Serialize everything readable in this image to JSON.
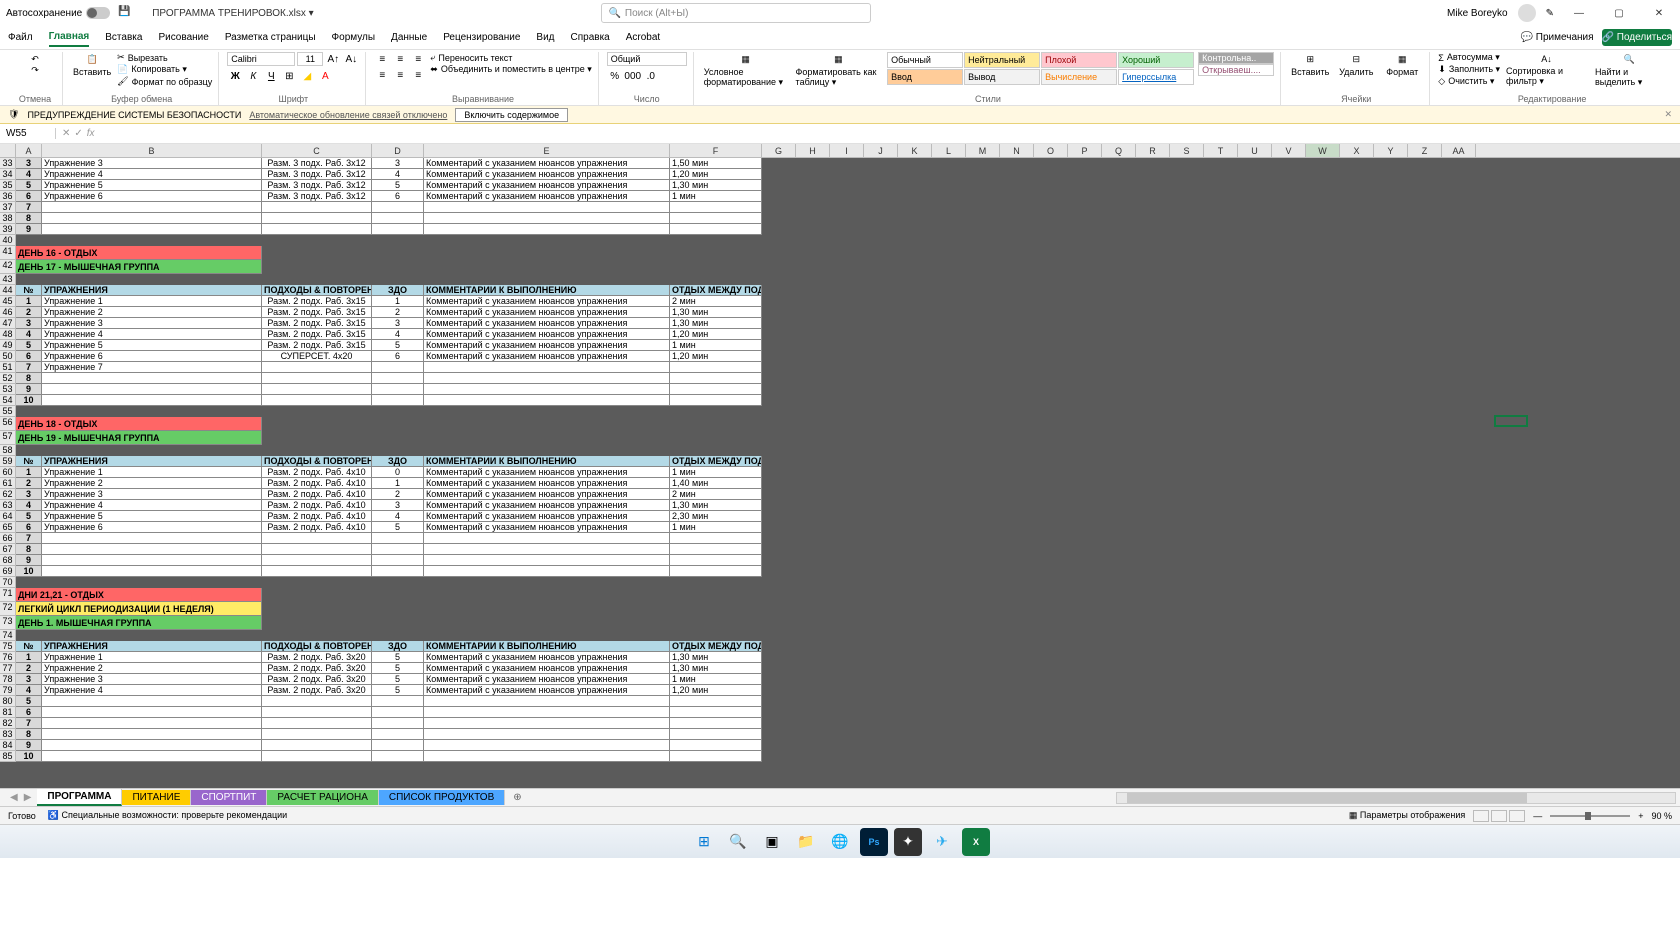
{
  "titleBar": {
    "autosave": "Автосохранение",
    "docTitle": "ПРОГРАММА ТРЕНИРОВОК.xlsx ▾",
    "searchPlaceholder": "Поиск (Alt+Ы)",
    "user": "Mike Boreyko"
  },
  "tabs": {
    "items": [
      "Файл",
      "Главная",
      "Вставка",
      "Рисование",
      "Разметка страницы",
      "Формулы",
      "Данные",
      "Рецензирование",
      "Вид",
      "Справка",
      "Acrobat"
    ],
    "active": "Главная",
    "comments": "Примечания",
    "share": "Поделиться"
  },
  "ribbon": {
    "undo": "Отмена",
    "paste": "Вставить",
    "clipboard": [
      "Вырезать",
      "Копировать ▾",
      "Формат по образцу"
    ],
    "clipboardLabel": "Буфер обмена",
    "font": "Calibri",
    "fontSize": "11",
    "fontLabel": "Шрифт",
    "wrap": "Переносить текст",
    "merge": "Объединить и поместить в центре ▾",
    "alignLabel": "Выравнивание",
    "numberFormat": "Общий",
    "numberLabel": "Число",
    "condFormat": "Условное форматирование ▾",
    "formatTable": "Форматировать как таблицу ▾",
    "styles": [
      "Обычный",
      "Нейтральный",
      "Плохой",
      "Хороший",
      "Ввод",
      "Вывод",
      "Вычисление",
      "Гиперссылка",
      "Контрольна..",
      "Открываеш...."
    ],
    "stylesLabel": "Стили",
    "insert": "Вставить",
    "delete": "Удалить",
    "format": "Формат",
    "cellsLabel": "Ячейки",
    "autosum": "Автосумма ▾",
    "fill": "Заполнить ▾",
    "clear": "Очистить ▾",
    "sort": "Сортировка и фильтр ▾",
    "find": "Найти и выделить ▾",
    "editLabel": "Редактирование"
  },
  "warning": {
    "label": "ПРЕДУПРЕЖДЕНИЕ СИСТЕМЫ БЕЗОПАСНОСТИ",
    "msg": "Автоматическое обновление связей отключено",
    "btn": "Включить содержимое"
  },
  "nameBox": "W55",
  "columns": [
    "A",
    "B",
    "C",
    "D",
    "E",
    "F",
    "G",
    "H",
    "I",
    "J",
    "K",
    "L",
    "M",
    "N",
    "O",
    "P",
    "Q",
    "R",
    "S",
    "T",
    "U",
    "V",
    "W",
    "X",
    "Y",
    "Z",
    "AA"
  ],
  "rowNums": [
    33,
    34,
    35,
    36,
    37,
    38,
    39,
    40,
    41,
    42,
    43,
    44,
    45,
    46,
    47,
    48,
    49,
    50,
    51,
    52,
    53,
    54,
    55,
    56,
    57,
    58,
    59,
    60,
    61,
    62,
    63,
    64,
    65,
    66,
    67,
    68,
    69,
    70,
    71,
    72,
    73,
    74,
    75,
    76,
    77,
    78,
    79,
    80,
    81,
    82,
    83,
    84,
    85
  ],
  "headers": {
    "num": "№",
    "ex": "УПРАЖНЕНИЯ",
    "sets": "ПОДХОДЫ & ПОВТОРЕНИЯ",
    "zdo": "ЗДО",
    "comm": "КОММЕНТАРИИ К ВЫПОЛНЕНИЮ",
    "rest": "ОТДЫХ МЕЖДУ ПОДХ."
  },
  "block1": {
    "rows": [
      {
        "n": "3",
        "ex": "Упражнение 3",
        "sets": "Разм. 3 подх. Раб. 3х12",
        "zdo": "3",
        "comm": "Комментарий с указанием нюансов упражнения",
        "rest": "1,50 мин"
      },
      {
        "n": "4",
        "ex": "Упражнение 4",
        "sets": "Разм. 3 подх. Раб. 3х12",
        "zdo": "4",
        "comm": "Комментарий с указанием нюансов упражнения",
        "rest": "1,20 мин"
      },
      {
        "n": "5",
        "ex": "Упражнение 5",
        "sets": "Разм. 3 подх. Раб. 3х12",
        "zdo": "5",
        "comm": "Комментарий с указанием нюансов упражнения",
        "rest": "1,30 мин"
      },
      {
        "n": "6",
        "ex": "Упражнение 6",
        "sets": "Разм. 3 подх. Раб. 3х12",
        "zdo": "6",
        "comm": "Комментарий с указанием нюансов упражнения",
        "rest": "1 мин"
      }
    ],
    "tail": [
      "7",
      "8",
      "9"
    ]
  },
  "day16": "ДЕНЬ 16 - ОТДЫХ",
  "day17": "ДЕНЬ 17 - МЫШЕЧНАЯ ГРУППА",
  "block2": {
    "rows": [
      {
        "n": "1",
        "ex": "Упражнение 1",
        "sets": "Разм. 2 подх. Раб. 3х15",
        "zdo": "1",
        "comm": "Комментарий с указанием нюансов упражнения",
        "rest": "2 мин"
      },
      {
        "n": "2",
        "ex": "Упражнение 2",
        "sets": "Разм. 2 подх. Раб. 3х15",
        "zdo": "2",
        "comm": "Комментарий с указанием нюансов упражнения",
        "rest": "1,30 мин"
      },
      {
        "n": "3",
        "ex": "Упражнение 3",
        "sets": "Разм. 2 подх. Раб. 3х15",
        "zdo": "3",
        "comm": "Комментарий с указанием нюансов упражнения",
        "rest": "1,30 мин"
      },
      {
        "n": "4",
        "ex": "Упражнение 4",
        "sets": "Разм. 2 подх. Раб. 3х15",
        "zdo": "4",
        "comm": "Комментарий с указанием нюансов упражнения",
        "rest": "1,20 мин"
      },
      {
        "n": "5",
        "ex": "Упражнение 5",
        "sets": "Разм. 2 подх. Раб. 3х15",
        "zdo": "5",
        "comm": "Комментарий с указанием нюансов упражнения",
        "rest": "1 мин"
      },
      {
        "n": "6",
        "ex": "Упражнение 6",
        "sets": "СУПЕРСЕТ. 4х20",
        "zdo": "6",
        "comm": "Комментарий с указанием нюансов упражнения",
        "rest": "1,20 мин"
      },
      {
        "n": "7",
        "ex": "Упражнение 7",
        "sets": "",
        "zdo": "",
        "comm": "",
        "rest": ""
      }
    ],
    "tail": [
      "8",
      "9",
      "10"
    ]
  },
  "day18": "ДЕНЬ 18 - ОТДЫХ",
  "day19": "ДЕНЬ 19 - МЫШЕЧНАЯ ГРУППА",
  "block3": {
    "rows": [
      {
        "n": "1",
        "ex": "Упражнение 1",
        "sets": "Разм. 2 подх. Раб. 4х10",
        "zdo": "0",
        "comm": "Комментарий с указанием нюансов упражнения",
        "rest": "1 мин"
      },
      {
        "n": "2",
        "ex": "Упражнение 2",
        "sets": "Разм. 2 подх. Раб. 4х10",
        "zdo": "1",
        "comm": "Комментарий с указанием нюансов упражнения",
        "rest": "1,40 мин"
      },
      {
        "n": "3",
        "ex": "Упражнение 3",
        "sets": "Разм. 2 подх. Раб. 4х10",
        "zdo": "2",
        "comm": "Комментарий с указанием нюансов упражнения",
        "rest": "2 мин"
      },
      {
        "n": "4",
        "ex": "Упражнение 4",
        "sets": "Разм. 2 подх. Раб. 4х10",
        "zdo": "3",
        "comm": "Комментарий с указанием нюансов упражнения",
        "rest": "1,30 мин"
      },
      {
        "n": "5",
        "ex": "Упражнение 5",
        "sets": "Разм. 2 подх. Раб. 4х10",
        "zdo": "4",
        "comm": "Комментарий с указанием нюансов упражнения",
        "rest": "2,30 мин"
      },
      {
        "n": "6",
        "ex": "Упражнение 6",
        "sets": "Разм. 2 подх. Раб. 4х10",
        "zdo": "5",
        "comm": "Комментарий с указанием нюансов упражнения",
        "rest": "1 мин"
      }
    ],
    "tail": [
      "7",
      "8",
      "9",
      "10"
    ]
  },
  "day21": "ДНИ 21,21 - ОТДЫХ",
  "lightCycle": "ЛЕГКИЙ ЦИКЛ ПЕРИОДИЗАЦИИ (1 НЕДЕЛЯ)",
  "day1": "ДЕНЬ 1. МЫШЕЧНАЯ ГРУППА",
  "block4": {
    "rows": [
      {
        "n": "1",
        "ex": "Упражнение 1",
        "sets": "Разм. 2 подх. Раб. 3х20",
        "zdo": "5",
        "comm": "Комментарий с указанием нюансов упражнения",
        "rest": "1,30 мин"
      },
      {
        "n": "2",
        "ex": "Упражнение 2",
        "sets": "Разм. 2 подх. Раб. 3х20",
        "zdo": "5",
        "comm": "Комментарий с указанием нюансов упражнения",
        "rest": "1,30 мин"
      },
      {
        "n": "3",
        "ex": "Упражнение 3",
        "sets": "Разм. 2 подх. Раб. 3х20",
        "zdo": "5",
        "comm": "Комментарий с указанием нюансов упражнения",
        "rest": "1 мин"
      },
      {
        "n": "4",
        "ex": "Упражнение 4",
        "sets": "Разм. 2 подх. Раб. 3х20",
        "zdo": "5",
        "comm": "Комментарий с указанием нюансов упражнения",
        "rest": "1,20 мин"
      }
    ],
    "tail": [
      "5",
      "6",
      "7",
      "8",
      "9",
      "10"
    ]
  },
  "sheetTabs": [
    "ПРОГРАММА",
    "ПИТАНИЕ",
    "СПОРТПИТ",
    "РАСЧЕТ РАЦИОНА",
    "СПИСОК ПРОДУКТОВ"
  ],
  "status": {
    "ready": "Готово",
    "access": "Специальные возможности: проверьте рекомендации",
    "display": "Параметры отображения",
    "zoom": "90 %"
  }
}
